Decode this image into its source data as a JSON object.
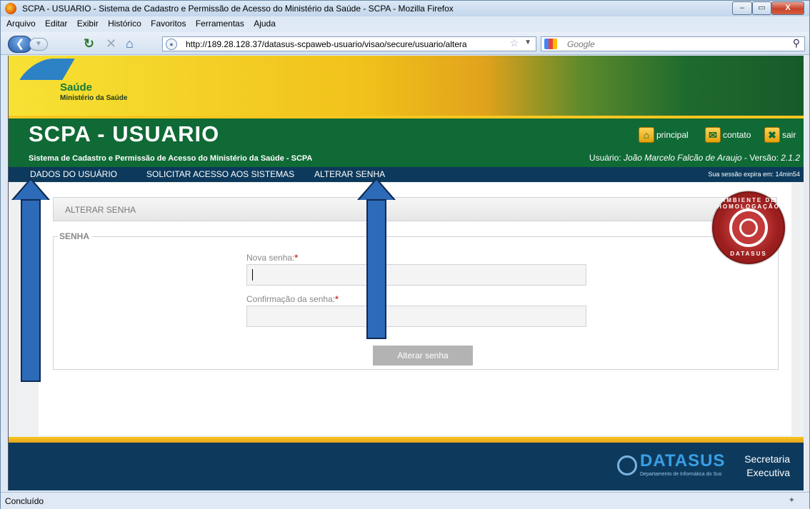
{
  "window": {
    "title": "SCPA - USUARIO - Sistema de Cadastro e Permissão de Acesso do Ministério da Saúde - SCPA - Mozilla Firefox",
    "minimize": "–",
    "maximize": "▭",
    "close": "X"
  },
  "menu": [
    "Arquivo",
    "Editar",
    "Exibir",
    "Histórico",
    "Favoritos",
    "Ferramentas",
    "Ajuda"
  ],
  "navigation": {
    "url": "http://189.28.128.37/datasus-scpaweb-usuario/visao/secure/usuario/altera",
    "search_placeholder": "Google"
  },
  "brand": {
    "name": "Saúde",
    "ministry": "Ministério da Saúde"
  },
  "header": {
    "title": "SCPA - USUARIO",
    "subtitle": "Sistema de Cadastro e Permissão de Acesso do Ministério da Saúde - SCPA",
    "user_prefix": "Usuário: ",
    "user_name": "João Marcelo Falcão de Araujo",
    "version_prefix": " - Versão: ",
    "version": "2.1.2",
    "links": {
      "principal": "principal",
      "contato": "contato",
      "sair": "sair"
    }
  },
  "tabs": {
    "dados": "DADOS DO USUÁRIO",
    "solicitar": "SOLICITAR ACESSO AOS SISTEMAS",
    "alterar": "ALTERAR SENHA",
    "session": "Sua sessão expira em: 14min54"
  },
  "form": {
    "section_title": "ALTERAR SENHA",
    "legend": "SENHA",
    "nova_label": "Nova senha:",
    "conf_label": "Confirmação da senha:",
    "required_mark": "*",
    "nova_value": "",
    "conf_value": "",
    "submit": "Alterar senha"
  },
  "stamp": {
    "top_text": "AMBIENTE DE HOMOLOGAÇÃO",
    "bottom_text": "DATASUS"
  },
  "footer": {
    "logo": "DATASUS",
    "logo_sub": "Departamento de Informática do Sus",
    "sec1": "Secretaria",
    "sec2": "Executiva"
  },
  "status": {
    "text": "Concluído"
  },
  "colors": {
    "green": "#0f6a35",
    "navy": "#0d3a5c",
    "yellow": "#f8c620",
    "arrow": "#2d6ab8"
  }
}
